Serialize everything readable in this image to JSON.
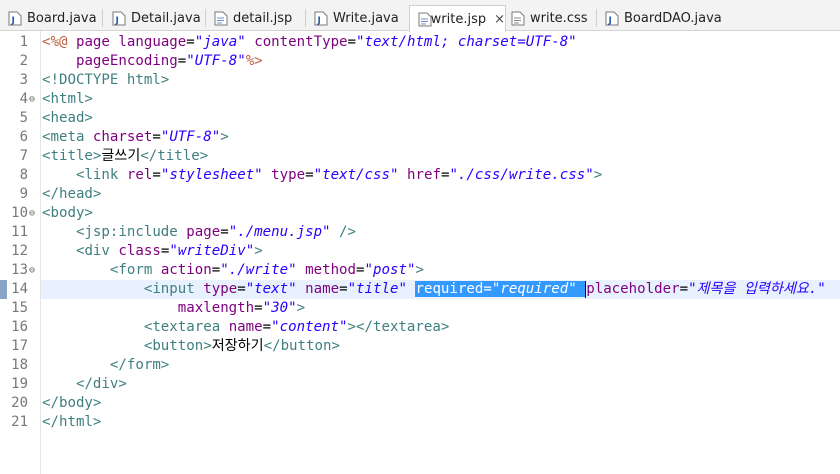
{
  "tabs": [
    {
      "label": "Board.java",
      "icon": "java-file-icon",
      "active": false
    },
    {
      "label": "Detail.java",
      "icon": "java-file-icon",
      "active": false
    },
    {
      "label": "detail.jsp",
      "icon": "jsp-file-icon",
      "active": false
    },
    {
      "label": "Write.java",
      "icon": "java-file-icon",
      "active": false
    },
    {
      "label": "write.jsp",
      "icon": "jsp-file-icon",
      "active": true,
      "close": "×"
    },
    {
      "label": "write.css",
      "icon": "css-file-icon",
      "active": false
    },
    {
      "label": "BoardDAO.java",
      "icon": "java-file-icon",
      "active": false
    }
  ],
  "editor": {
    "current_line": 14,
    "lines": [
      {
        "n": "1",
        "fold": "",
        "tokens": [
          [
            "dir",
            "<%@ "
          ],
          [
            "attr",
            "page "
          ],
          [
            "attr",
            "language"
          ],
          [
            "txt",
            "="
          ],
          [
            "val",
            "\"java\""
          ],
          [
            "txt",
            " "
          ],
          [
            "attr",
            "contentType"
          ],
          [
            "txt",
            "="
          ],
          [
            "val",
            "\"text/html; charset=UTF-8\""
          ]
        ]
      },
      {
        "n": "2",
        "fold": "",
        "tokens": [
          [
            "txt",
            "    "
          ],
          [
            "attr",
            "pageEncoding"
          ],
          [
            "txt",
            "="
          ],
          [
            "val",
            "\"UTF-8\""
          ],
          [
            "dir",
            "%>"
          ]
        ]
      },
      {
        "n": "3",
        "fold": "",
        "tokens": [
          [
            "tag",
            "<!DOCTYPE html>"
          ]
        ]
      },
      {
        "n": "4",
        "fold": "⊖",
        "tokens": [
          [
            "tag",
            "<html>"
          ]
        ]
      },
      {
        "n": "5",
        "fold": "",
        "tokens": [
          [
            "tag",
            "<head>"
          ]
        ]
      },
      {
        "n": "6",
        "fold": "",
        "tokens": [
          [
            "tag",
            "<meta "
          ],
          [
            "attr",
            "charset"
          ],
          [
            "txt",
            "="
          ],
          [
            "val",
            "\"UTF-8\""
          ],
          [
            "tag",
            ">"
          ]
        ]
      },
      {
        "n": "7",
        "fold": "",
        "tokens": [
          [
            "tag",
            "<title>"
          ],
          [
            "txt",
            "글쓰기"
          ],
          [
            "tag",
            "</title>"
          ]
        ]
      },
      {
        "n": "8",
        "fold": "",
        "tokens": [
          [
            "txt",
            "    "
          ],
          [
            "tag",
            "<link "
          ],
          [
            "attr",
            "rel"
          ],
          [
            "txt",
            "="
          ],
          [
            "val",
            "\"stylesheet\""
          ],
          [
            "txt",
            " "
          ],
          [
            "attr",
            "type"
          ],
          [
            "txt",
            "="
          ],
          [
            "val",
            "\"text/css\""
          ],
          [
            "txt",
            " "
          ],
          [
            "attr",
            "href"
          ],
          [
            "txt",
            "="
          ],
          [
            "val",
            "\"./css/write.css\""
          ],
          [
            "tag",
            ">"
          ]
        ]
      },
      {
        "n": "9",
        "fold": "",
        "tokens": [
          [
            "tag",
            "</head>"
          ]
        ]
      },
      {
        "n": "10",
        "fold": "⊖",
        "tokens": [
          [
            "tag",
            "<body>"
          ]
        ]
      },
      {
        "n": "11",
        "fold": "",
        "tokens": [
          [
            "txt",
            "    "
          ],
          [
            "tag",
            "<jsp:include "
          ],
          [
            "attr",
            "page"
          ],
          [
            "txt",
            "="
          ],
          [
            "val",
            "\"./menu.jsp\""
          ],
          [
            "txt",
            " "
          ],
          [
            "tag",
            "/>"
          ]
        ]
      },
      {
        "n": "12",
        "fold": "",
        "tokens": [
          [
            "txt",
            "    "
          ],
          [
            "tag",
            "<div "
          ],
          [
            "attr",
            "class"
          ],
          [
            "txt",
            "="
          ],
          [
            "val",
            "\"writeDiv\""
          ],
          [
            "tag",
            ">"
          ]
        ]
      },
      {
        "n": "13",
        "fold": "⊖",
        "tokens": [
          [
            "txt",
            "        "
          ],
          [
            "tag",
            "<form "
          ],
          [
            "attr",
            "action"
          ],
          [
            "txt",
            "="
          ],
          [
            "val",
            "\"./write\""
          ],
          [
            "txt",
            " "
          ],
          [
            "attr",
            "method"
          ],
          [
            "txt",
            "="
          ],
          [
            "val",
            "\"post\""
          ],
          [
            "tag",
            ">"
          ]
        ]
      },
      {
        "n": "14",
        "fold": "",
        "tokens": [
          [
            "txt",
            "            "
          ],
          [
            "tag",
            "<input "
          ],
          [
            "attr",
            "type"
          ],
          [
            "txt",
            "="
          ],
          [
            "val",
            "\"text\""
          ],
          [
            "txt",
            " "
          ],
          [
            "attr",
            "name"
          ],
          [
            "txt",
            "="
          ],
          [
            "val",
            "\"title\""
          ],
          [
            "txt",
            " "
          ],
          [
            "sel-attr",
            "required"
          ],
          [
            "sel-txt",
            "="
          ],
          [
            "sel-val",
            "\"required\""
          ],
          [
            "sel-txt",
            " "
          ],
          [
            "caret",
            ""
          ],
          [
            "attr",
            "placeholder"
          ],
          [
            "txt",
            "="
          ],
          [
            "val",
            "\"제목을 입력하세요.\""
          ]
        ]
      },
      {
        "n": "15",
        "fold": "",
        "tokens": [
          [
            "txt",
            "                "
          ],
          [
            "attr",
            "maxlength"
          ],
          [
            "txt",
            "="
          ],
          [
            "val",
            "\"30\""
          ],
          [
            "tag",
            ">"
          ]
        ]
      },
      {
        "n": "16",
        "fold": "",
        "tokens": [
          [
            "txt",
            "            "
          ],
          [
            "tag",
            "<textarea "
          ],
          [
            "attr",
            "name"
          ],
          [
            "txt",
            "="
          ],
          [
            "val",
            "\"content\""
          ],
          [
            "tag",
            "></textarea>"
          ]
        ]
      },
      {
        "n": "17",
        "fold": "",
        "tokens": [
          [
            "txt",
            "            "
          ],
          [
            "tag",
            "<button>"
          ],
          [
            "txt",
            "저장하기"
          ],
          [
            "tag",
            "</button>"
          ]
        ]
      },
      {
        "n": "18",
        "fold": "",
        "tokens": [
          [
            "txt",
            "        "
          ],
          [
            "tag",
            "</form>"
          ]
        ]
      },
      {
        "n": "19",
        "fold": "",
        "tokens": [
          [
            "txt",
            "    "
          ],
          [
            "tag",
            "</div>"
          ]
        ]
      },
      {
        "n": "20",
        "fold": "",
        "tokens": [
          [
            "tag",
            "</body>"
          ]
        ]
      },
      {
        "n": "21",
        "fold": "",
        "tokens": [
          [
            "tag",
            "</html>"
          ]
        ]
      }
    ]
  }
}
